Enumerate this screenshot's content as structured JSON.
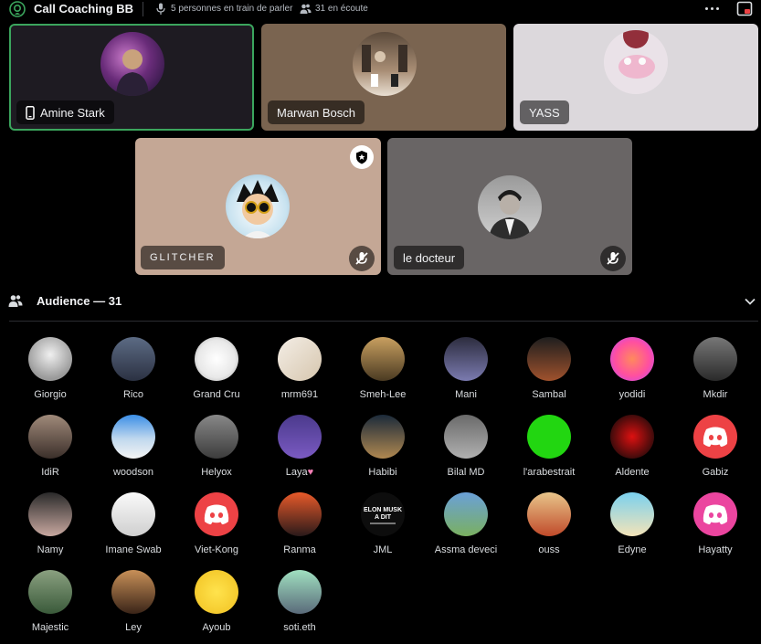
{
  "header": {
    "title": "Call Coaching BB",
    "speaking": "5 personnes en train de parler",
    "listening": "31 en écoute"
  },
  "stage": {
    "speakers": [
      {
        "name": "Amine Stark",
        "icon": "mobile-phone-icon",
        "active": true
      },
      {
        "name": "Marwan Bosch"
      },
      {
        "name": "YASS"
      },
      {
        "name": "GLITCHER",
        "moderator": true,
        "muted": true
      },
      {
        "name": "le docteur",
        "muted": true
      }
    ]
  },
  "audience": {
    "title": "Audience — 31",
    "members": [
      {
        "name": "Giorgio"
      },
      {
        "name": "Rico"
      },
      {
        "name": "Grand Cru"
      },
      {
        "name": "mrm691"
      },
      {
        "name": "Smeh-Lee"
      },
      {
        "name": "Mani"
      },
      {
        "name": "Sambal"
      },
      {
        "name": "yodidi"
      },
      {
        "name": "Mkdir"
      },
      {
        "name": "IdiR"
      },
      {
        "name": "woodson"
      },
      {
        "name": "Helyox"
      },
      {
        "name": "Laya",
        "suffix": "♥"
      },
      {
        "name": "Habibi"
      },
      {
        "name": "Bilal MD"
      },
      {
        "name": "l'arabestrait"
      },
      {
        "name": "Aldente"
      },
      {
        "name": "Gabiz"
      },
      {
        "name": "Namy"
      },
      {
        "name": "Imane Swab"
      },
      {
        "name": "Viet-Kong"
      },
      {
        "name": "Ranma"
      },
      {
        "name": "JML"
      },
      {
        "name": "Assma deveci"
      },
      {
        "name": "ouss"
      },
      {
        "name": "Edyne"
      },
      {
        "name": "Hayatty"
      },
      {
        "name": "Majestic"
      },
      {
        "name": "Ley"
      },
      {
        "name": "Ayoub"
      },
      {
        "name": "soti.eth"
      }
    ]
  },
  "colors": {
    "accent_green": "#3ba55d",
    "discord_red": "#ed4245",
    "discord_pink": "#eb459f",
    "background": "#000000"
  }
}
